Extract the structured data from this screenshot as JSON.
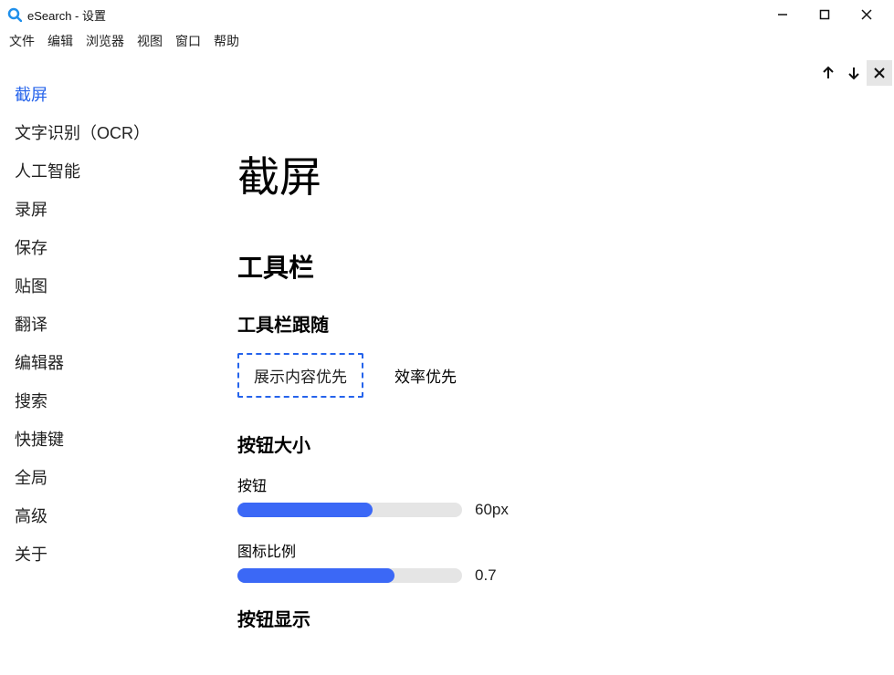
{
  "window": {
    "title": "eSearch - 设置"
  },
  "menubar": {
    "items": [
      "文件",
      "编辑",
      "浏览器",
      "视图",
      "窗口",
      "帮助"
    ]
  },
  "sidebar": {
    "items": [
      {
        "label": "截屏",
        "active": true
      },
      {
        "label": "文字识别（OCR）"
      },
      {
        "label": "人工智能"
      },
      {
        "label": "录屏"
      },
      {
        "label": "保存"
      },
      {
        "label": "贴图"
      },
      {
        "label": "翻译"
      },
      {
        "label": "编辑器"
      },
      {
        "label": "搜索"
      },
      {
        "label": "快捷键"
      },
      {
        "label": "全局"
      },
      {
        "label": "高级"
      },
      {
        "label": "关于"
      }
    ]
  },
  "main": {
    "heading": "截屏",
    "section_toolbar": "工具栏",
    "section_follow": "工具栏跟随",
    "follow_options": {
      "opt1": "展示内容优先",
      "opt2": "效率优先"
    },
    "section_button_size": "按钮大小",
    "slider_button": {
      "label": "按钮",
      "value": "60px",
      "percent": 60
    },
    "slider_icon": {
      "label": "图标比例",
      "value": "0.7",
      "percent": 70
    },
    "section_button_display": "按钮显示"
  }
}
